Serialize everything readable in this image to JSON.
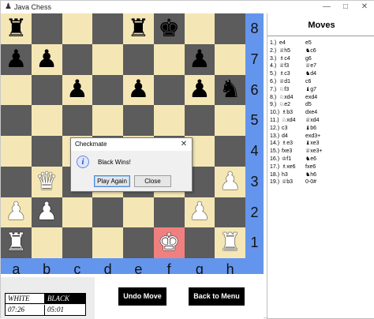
{
  "window": {
    "title": "Java Chess",
    "controls": [
      "—",
      "□",
      "✕"
    ]
  },
  "board": {
    "colors": {
      "light": "#f5e7b5",
      "dark": "#5c5c5c",
      "check": "#f08080",
      "frame": "#6495ed"
    },
    "ranks": [
      "8",
      "7",
      "6",
      "5",
      "4",
      "3",
      "2",
      "1"
    ],
    "files": [
      "a",
      "b",
      "c",
      "d",
      "e",
      "f",
      "g",
      "h"
    ],
    "check_square": "f1",
    "pieces": [
      {
        "square": "a8",
        "color": "black",
        "type": "rook",
        "glyph": "♜"
      },
      {
        "square": "e8",
        "color": "black",
        "type": "rook",
        "glyph": "♜"
      },
      {
        "square": "f8",
        "color": "black",
        "type": "king",
        "glyph": "♚"
      },
      {
        "square": "a7",
        "color": "black",
        "type": "pawn",
        "glyph": "♟"
      },
      {
        "square": "b7",
        "color": "black",
        "type": "pawn",
        "glyph": "♟"
      },
      {
        "square": "g7",
        "color": "black",
        "type": "pawn",
        "glyph": "♟"
      },
      {
        "square": "c6",
        "color": "black",
        "type": "pawn",
        "glyph": "♟"
      },
      {
        "square": "e6",
        "color": "black",
        "type": "pawn",
        "glyph": "♟"
      },
      {
        "square": "g6",
        "color": "black",
        "type": "pawn",
        "glyph": "♟"
      },
      {
        "square": "h6",
        "color": "black",
        "type": "knight",
        "glyph": "♞"
      },
      {
        "square": "b3",
        "color": "white",
        "type": "queen",
        "glyph": "♛"
      },
      {
        "square": "h3",
        "color": "white",
        "type": "pawn",
        "glyph": "♟"
      },
      {
        "square": "a2",
        "color": "white",
        "type": "pawn",
        "glyph": "♟"
      },
      {
        "square": "b2",
        "color": "white",
        "type": "pawn",
        "glyph": "♟"
      },
      {
        "square": "g2",
        "color": "white",
        "type": "pawn",
        "glyph": "♟"
      },
      {
        "square": "a1",
        "color": "white",
        "type": "rook",
        "glyph": "♜"
      },
      {
        "square": "f1",
        "color": "white",
        "type": "king",
        "glyph": "♚"
      },
      {
        "square": "h1",
        "color": "white",
        "type": "rook",
        "glyph": "♜"
      }
    ]
  },
  "clock": {
    "white_label": "WHITE",
    "black_label": "BLACK",
    "white_time": "07:26",
    "black_time": "05:01"
  },
  "buttons": {
    "undo": "Undo Move",
    "menu": "Back to Menu"
  },
  "moves": {
    "title": "Moves",
    "list": [
      {
        "num": "1.)",
        "white": "e4",
        "black": "e5"
      },
      {
        "num": "2.)",
        "white": "♕h5",
        "black": "♞c6"
      },
      {
        "num": "3.)",
        "white": "♗c4",
        "black": "g6"
      },
      {
        "num": "4.)",
        "white": "♕f3",
        "black": "♕e7"
      },
      {
        "num": "5.)",
        "white": "♗c3",
        "black": "♞d4"
      },
      {
        "num": "6.)",
        "white": "♕d1",
        "black": "c6"
      },
      {
        "num": "7.)",
        "white": "♘f3",
        "black": "♝g7"
      },
      {
        "num": "8.)",
        "white": "♘xd4",
        "black": "exd4"
      },
      {
        "num": "9.)",
        "white": "♘e2",
        "black": "d5"
      },
      {
        "num": "10.)",
        "white": "♗b3",
        "black": "dxe4"
      },
      {
        "num": "11.)",
        "white": "♘xd4",
        "black": "♕xd4"
      },
      {
        "num": "12.)",
        "white": "c3",
        "black": "♝b6"
      },
      {
        "num": "13.)",
        "white": "d4",
        "black": "exd3+"
      },
      {
        "num": "14.)",
        "white": "♗e3",
        "black": "♝xe3"
      },
      {
        "num": "15.)",
        "white": "fxe3",
        "black": "♕xe3+"
      },
      {
        "num": "16.)",
        "white": "♔f1",
        "black": "♞e6"
      },
      {
        "num": "17.)",
        "white": "♗xe6",
        "black": "fxe6"
      },
      {
        "num": "18.)",
        "white": "h3",
        "black": "♞h6"
      },
      {
        "num": "19.)",
        "white": "♕b3",
        "black": "0-0#"
      }
    ]
  },
  "dialog": {
    "title": "Checkmate",
    "icon": "information-icon",
    "icon_glyph": "i",
    "message": "Black Wins!",
    "play_again": "Play Again",
    "close": "Close",
    "close_glyph": "✕"
  }
}
